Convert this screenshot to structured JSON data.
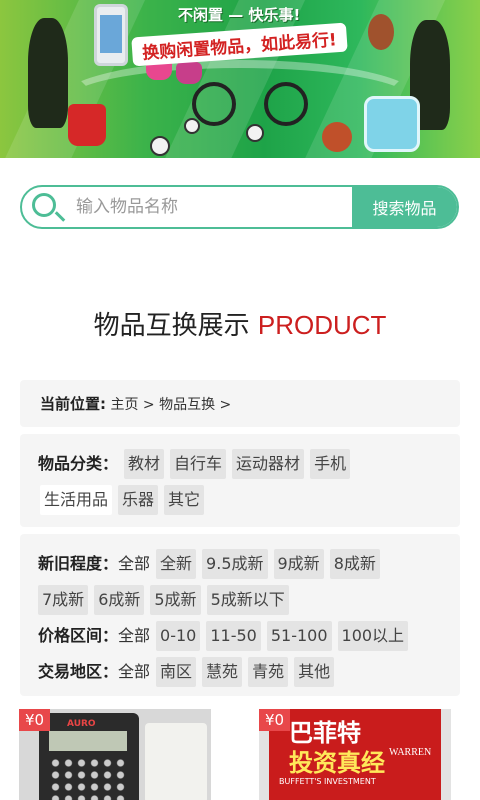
{
  "banner": {
    "slogan1": "不闲置 — 快乐事!",
    "slogan2": "换购闲置物品，如此易行!"
  },
  "search": {
    "placeholder": "输入物品名称",
    "button": "搜索物品"
  },
  "section": {
    "title_cn": "物品互换展示",
    "title_en": "PRODUCT"
  },
  "breadcrumb": {
    "label": "当前位置:",
    "path": "主页 > 物品互换 >"
  },
  "category": {
    "label": "物品分类：",
    "items": [
      "教材",
      "自行车",
      "运动器材",
      "手机",
      "生活用品",
      "乐器",
      "其它"
    ]
  },
  "condition": {
    "label": "新旧程度：",
    "all": "全部",
    "items": [
      "全新",
      "9.5成新",
      "9成新",
      "8成新",
      "7成新",
      "6成新",
      "5成新",
      "5成新以下"
    ]
  },
  "price_range": {
    "label": "价格区间：",
    "all": "全部",
    "items": [
      "0-10",
      "11-50",
      "51-100",
      "100以上"
    ]
  },
  "area": {
    "label": "交易地区：",
    "all": "全部",
    "items": [
      "南区",
      "慧苑",
      "青苑",
      "其他"
    ]
  },
  "products": [
    {
      "price": "¥0"
    },
    {
      "price": "¥0"
    }
  ],
  "book_cover": {
    "line1": "巴菲特",
    "line2": "投资真经",
    "subtitle": "BUFFETT'S INVESTMENT",
    "overlay": "WARREN"
  },
  "calculator_brand": "AURO",
  "colors": {
    "accent": "#4dbd96",
    "title_en": "#cc1f1f",
    "price_badge": "#e8474a"
  }
}
